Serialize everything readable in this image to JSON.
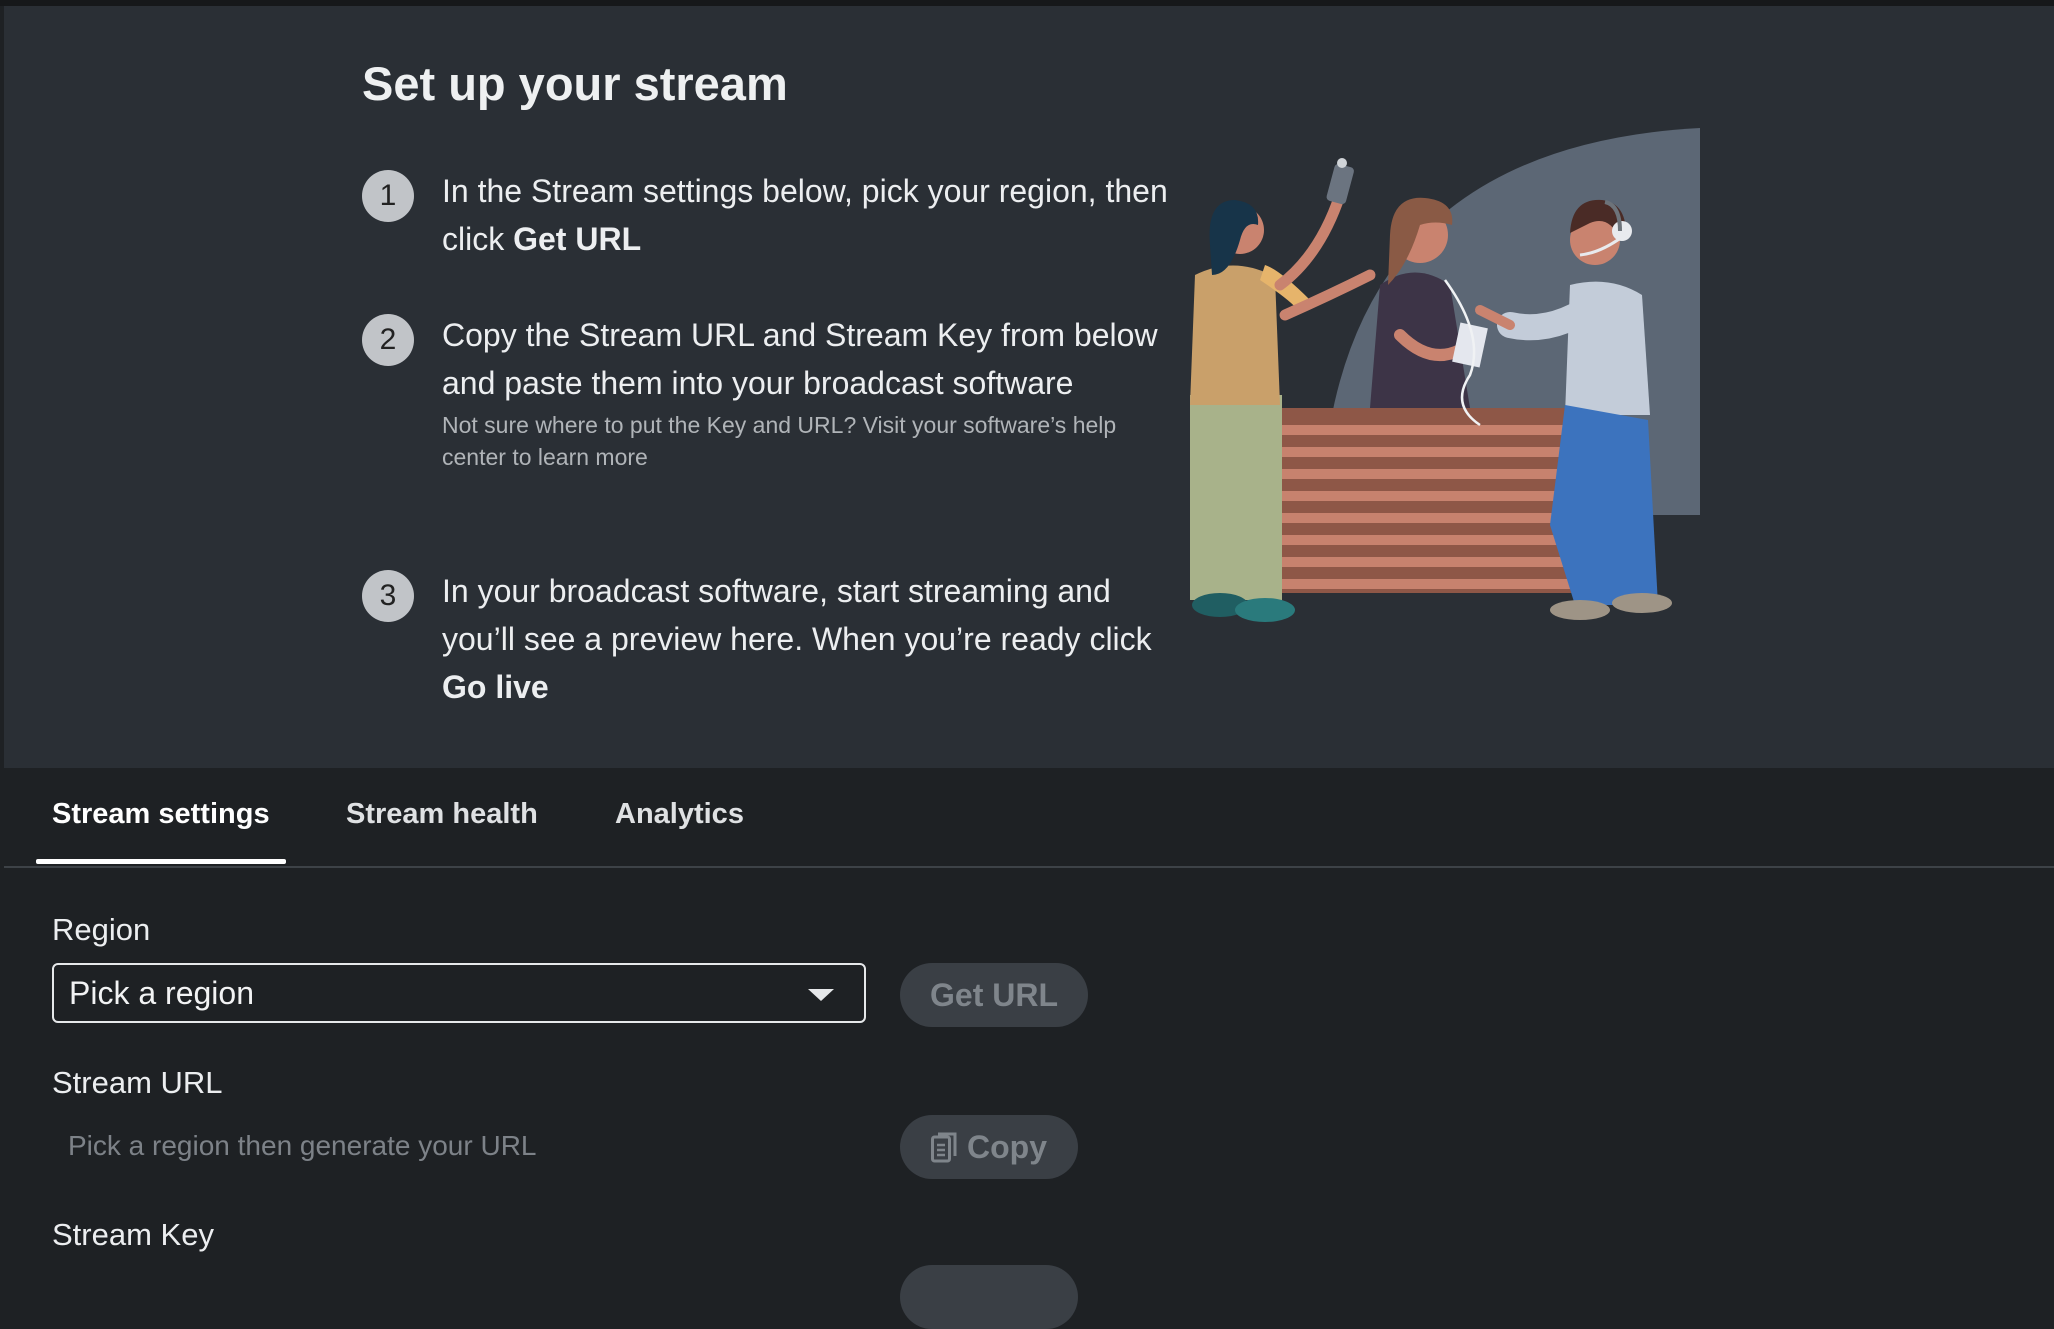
{
  "hero": {
    "title": "Set up your stream",
    "steps": [
      {
        "number": "1",
        "text_a": "In the Stream settings below, pick your region, then click ",
        "text_bold": "Get URL",
        "text_b": ""
      },
      {
        "number": "2",
        "text_a": "Copy the Stream URL and Stream Key from below and paste them into your broadcast software",
        "sub": "Not sure where to put the Key and URL? Visit your software’s help center to learn more"
      },
      {
        "number": "3",
        "text_a": "In your broadcast software, start streaming and you’ll see a preview here. When you’re ready click ",
        "text_bold": "Go live"
      }
    ]
  },
  "tabs": [
    {
      "label": "Stream settings",
      "active": true
    },
    {
      "label": "Stream health",
      "active": false
    },
    {
      "label": "Analytics",
      "active": false
    }
  ],
  "settings": {
    "region_label": "Region",
    "region_value": "Pick a region",
    "get_url_label": "Get URL",
    "stream_url_label": "Stream URL",
    "stream_url_placeholder": "Pick a region then generate your URL",
    "copy_label": "Copy",
    "stream_key_label": "Stream Key"
  }
}
